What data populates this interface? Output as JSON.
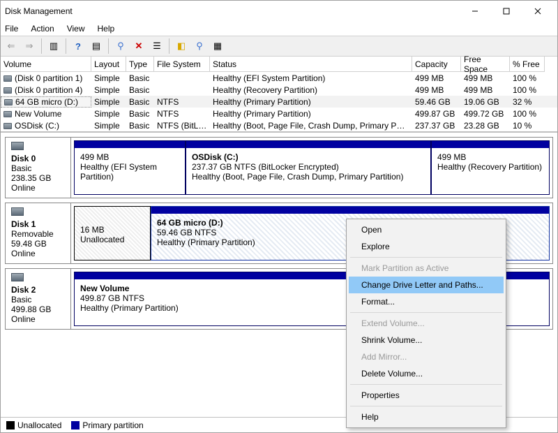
{
  "window": {
    "title": "Disk Management"
  },
  "menu": {
    "file": "File",
    "action": "Action",
    "view": "View",
    "help": "Help"
  },
  "columns": {
    "volume": "Volume",
    "layout": "Layout",
    "type": "Type",
    "fs": "File System",
    "status": "Status",
    "capacity": "Capacity",
    "free": "Free Space",
    "pct": "% Free"
  },
  "volumes": [
    {
      "name": "(Disk 0 partition 1)",
      "layout": "Simple",
      "type": "Basic",
      "fs": "",
      "status": "Healthy (EFI System Partition)",
      "capacity": "499 MB",
      "free": "499 MB",
      "pct": "100 %"
    },
    {
      "name": "(Disk 0 partition 4)",
      "layout": "Simple",
      "type": "Basic",
      "fs": "",
      "status": "Healthy (Recovery Partition)",
      "capacity": "499 MB",
      "free": "499 MB",
      "pct": "100 %"
    },
    {
      "name": "64 GB micro (D:)",
      "layout": "Simple",
      "type": "Basic",
      "fs": "NTFS",
      "status": "Healthy (Primary Partition)",
      "capacity": "59.46 GB",
      "free": "19.06 GB",
      "pct": "32 %"
    },
    {
      "name": "New Volume",
      "layout": "Simple",
      "type": "Basic",
      "fs": "NTFS",
      "status": "Healthy (Primary Partition)",
      "capacity": "499.87 GB",
      "free": "499.72 GB",
      "pct": "100 %"
    },
    {
      "name": "OSDisk (C:)",
      "layout": "Simple",
      "type": "Basic",
      "fs": "NTFS (BitLo...",
      "status": "Healthy (Boot, Page File, Crash Dump, Primary Partition)",
      "capacity": "237.37 GB",
      "free": "23.28 GB",
      "pct": "10 %"
    }
  ],
  "disks": [
    {
      "name": "Disk 0",
      "type": "Basic",
      "size": "238.35 GB",
      "state": "Online",
      "parts": [
        {
          "title": "",
          "line1": "499 MB",
          "line2": "Healthy (EFI System Partition)"
        },
        {
          "title": "OSDisk  (C:)",
          "line1": "237.37 GB NTFS (BitLocker Encrypted)",
          "line2": "Healthy (Boot, Page File, Crash Dump, Primary Partition)"
        },
        {
          "title": "",
          "line1": "499 MB",
          "line2": "Healthy (Recovery Partition)"
        }
      ]
    },
    {
      "name": "Disk 1",
      "type": "Removable",
      "size": "59.48 GB",
      "state": "Online",
      "parts": [
        {
          "title": "",
          "line1": "16 MB",
          "line2": "Unallocated",
          "unalloc": true
        },
        {
          "title": "64 GB micro  (D:)",
          "line1": "59.46 GB NTFS",
          "line2": "Healthy (Primary Partition)",
          "selected": true
        }
      ]
    },
    {
      "name": "Disk 2",
      "type": "Basic",
      "size": "499.88 GB",
      "state": "Online",
      "parts": [
        {
          "title": "New Volume",
          "line1": "499.87 GB NTFS",
          "line2": "Healthy (Primary Partition)"
        }
      ]
    }
  ],
  "legend": {
    "unalloc": "Unallocated",
    "primary": "Primary partition"
  },
  "context_menu": {
    "open": "Open",
    "explore": "Explore",
    "mark_active": "Mark Partition as Active",
    "change_letter": "Change Drive Letter and Paths...",
    "format": "Format...",
    "extend": "Extend Volume...",
    "shrink": "Shrink Volume...",
    "add_mirror": "Add Mirror...",
    "delete": "Delete Volume...",
    "properties": "Properties",
    "help": "Help"
  }
}
